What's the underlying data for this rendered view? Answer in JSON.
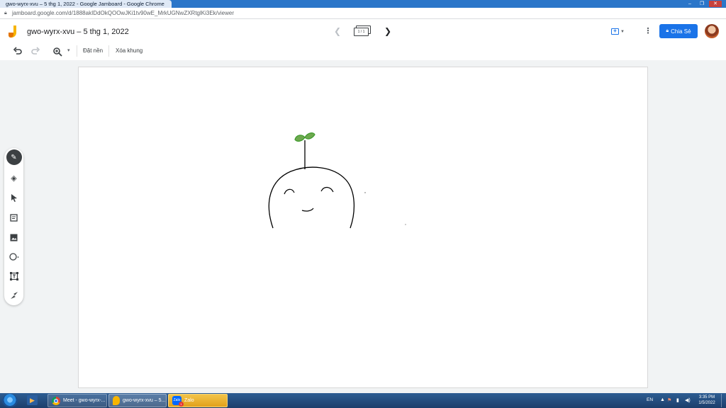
{
  "window": {
    "title": "gwo-wyrx-xvu – 5 thg 1, 2022 - Google Jamboard - Google Chrome"
  },
  "address_bar": {
    "url": "jamboard.google.com/d/1888akIDdOkQOOwJKi1tv90wE_MrkUGNwZXRtglKi3Ek/viewer"
  },
  "header": {
    "doc_title": "gwo-wyrx-xvu – 5 thg 1, 2022",
    "frame_indicator": "1 / 1",
    "share_label": "Chia Sẻ"
  },
  "toolbar": {
    "set_background_label": "Đặt nền",
    "clear_frame_label": "Xóa khung"
  },
  "side_tools": [
    "pen",
    "eraser",
    "select",
    "sticky-note",
    "image",
    "circle",
    "text-box",
    "laser"
  ],
  "taskbar": {
    "items": [
      {
        "label": "Meet - gwo-wyrx-..."
      },
      {
        "label": "gwo-wyrx-xvu – 5..."
      },
      {
        "label": "Zalo"
      }
    ],
    "zalo_badge": "1",
    "language": "EN",
    "time": "3:35 PM",
    "date": "1/5/2022"
  },
  "colors": {
    "accent": "#1a73e8",
    "sprout": "#3f9b2e",
    "ink": "#000000",
    "title_bar": "#2b76c9",
    "taskbar": "#2d5d93"
  }
}
